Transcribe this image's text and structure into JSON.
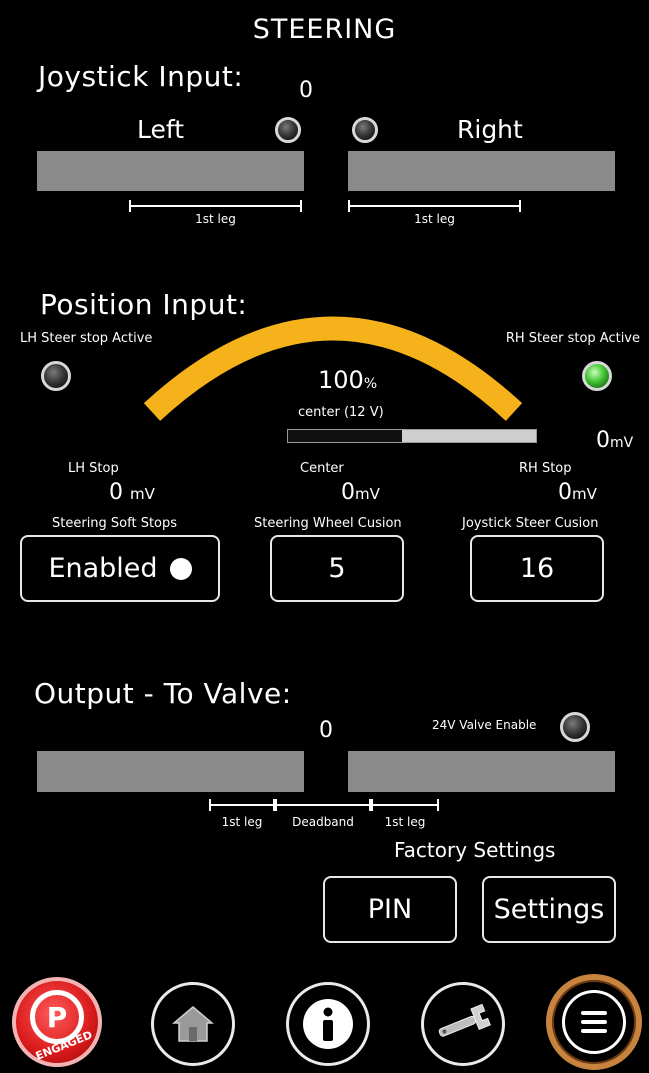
{
  "title": "STEERING",
  "joystick": {
    "heading": "Joystick Input:",
    "value": "0",
    "left_label": "Left",
    "right_label": "Right",
    "left_leg_label": "1st leg",
    "right_leg_label": "1st leg"
  },
  "position": {
    "heading": "Position Input:",
    "lh_stop_active_label": "LH Steer stop Active",
    "rh_stop_active_label": "RH Steer stop Active",
    "percent_value": "100",
    "percent_unit": "%",
    "center_label": "center (12 V)",
    "center_bar_fill": 0.54,
    "reading_value": "0",
    "reading_unit": "mV",
    "lh_stop_label": "LH Stop",
    "lh_stop_value": "0",
    "lh_stop_unit": "mV",
    "center_stop_label": "Center",
    "center_stop_value": "0",
    "center_stop_unit": "mV",
    "rh_stop_label": "RH Stop",
    "rh_stop_value": "0",
    "rh_stop_unit": "mV",
    "lh_led_state": "off",
    "rh_led_state": "green",
    "arc_color": "#f6b21a"
  },
  "settings": {
    "soft_stops_label": "Steering Soft Stops",
    "soft_stops_value": "Enabled",
    "wheel_cushion_label": "Steering Wheel Cusion",
    "wheel_cushion_value": "5",
    "joystick_cushion_label": "Joystick Steer Cusion",
    "joystick_cushion_value": "16"
  },
  "output": {
    "heading": "Output - To Valve:",
    "value": "0",
    "valve_enable_label": "24V Valve Enable",
    "leg1_label": "1st leg",
    "deadband_label": "Deadband",
    "leg2_label": "1st leg"
  },
  "factory": {
    "label": "Factory Settings",
    "pin_button": "PIN",
    "settings_button": "Settings"
  },
  "nav": {
    "parking_letter": "P",
    "parking_status": "ENGAGED",
    "icons": [
      "parking-brake-icon",
      "home-icon",
      "info-icon",
      "wrench-icon",
      "menu-icon"
    ]
  }
}
